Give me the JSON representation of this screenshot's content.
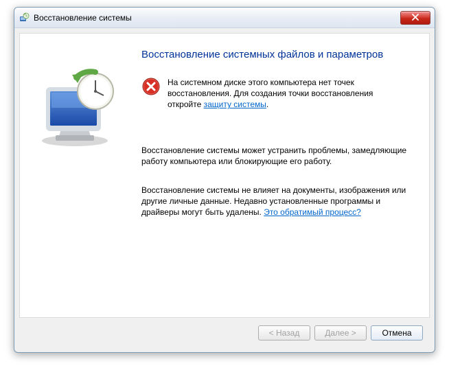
{
  "window": {
    "title": "Восстановление системы"
  },
  "content": {
    "heading": "Восстановление системных файлов и параметров",
    "error": {
      "text_pre": "На системном диске этого компьютера нет точек восстановления. Для создания точки восстановления откройте ",
      "link": "защиту системы",
      "text_post": "."
    },
    "p1": "Восстановление системы может устранить проблемы, замедляющие работу компьютера или блокирующие его работу.",
    "p2_pre": "Восстановление системы не влияет на документы, изображения или другие личные данные. Недавно установленные программы и драйверы могут быть удалены. ",
    "p2_link": "Это обратимый процесс?"
  },
  "buttons": {
    "back": "< Назад",
    "next": "Далее >",
    "cancel": "Отмена"
  }
}
